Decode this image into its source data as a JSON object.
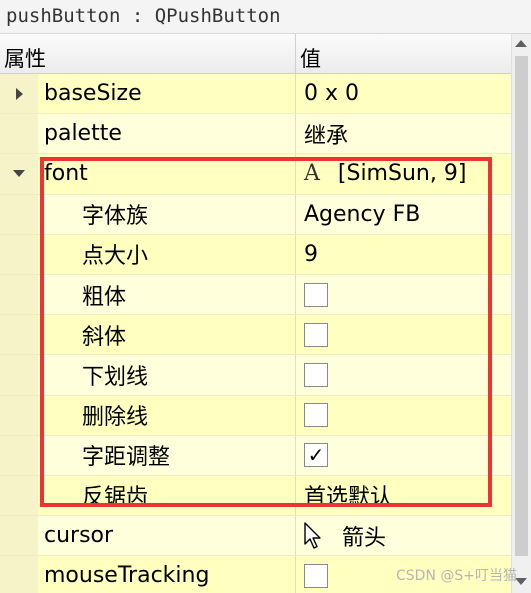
{
  "object_header": "pushButton : QPushButton",
  "columns": {
    "property": "属性",
    "value": "值"
  },
  "rows": [
    {
      "name": "baseSize",
      "value": "0 x 0"
    },
    {
      "name": "palette",
      "value": "继承"
    },
    {
      "name": "font",
      "value": "[SimSun, 9]",
      "icon_glyph": "A"
    },
    {
      "name": "字体族",
      "value": "Agency FB"
    },
    {
      "name": "点大小",
      "value": "9"
    },
    {
      "name": "粗体",
      "checked": false
    },
    {
      "name": "斜体",
      "checked": false
    },
    {
      "name": "下划线",
      "checked": false
    },
    {
      "name": "删除线",
      "checked": false
    },
    {
      "name": "字距调整",
      "checked": true,
      "check_glyph": "✓"
    },
    {
      "name": "反锯齿",
      "value": "首选默认"
    },
    {
      "name": "cursor",
      "value": "箭头"
    },
    {
      "name": "mouseTracking",
      "checked": false
    }
  ],
  "watermark": "CSDN @S+叮当猫",
  "colors": {
    "row_alt": "#ffffbf",
    "row_plain": "#ffffdc",
    "highlight": "#ee3333"
  },
  "icons": {
    "expand_collapsed": "triangle-right-icon",
    "expand_open": "triangle-down-icon",
    "font": "font-icon",
    "cursor": "arrow-cursor-icon"
  }
}
